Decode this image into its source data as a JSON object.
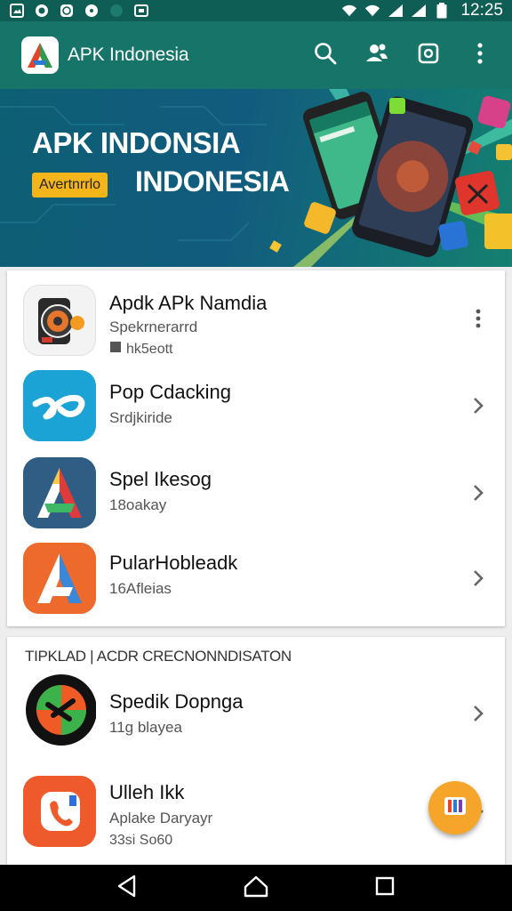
{
  "status_bar": {
    "time": "12:25",
    "icons": [
      "photo-icon",
      "chat-icon",
      "whatsapp-icon",
      "circle-icon",
      "gallery-icon",
      "hotspot-icon",
      "wifi-icon",
      "signal-icon",
      "battery-icon"
    ]
  },
  "app_bar": {
    "title": "APK Indonesia",
    "actions": [
      "search-icon",
      "users-icon",
      "screenshot-icon",
      "more-icon"
    ]
  },
  "banner": {
    "title": "APK INDONSIA",
    "badge": "Avertnrrlo",
    "subtitle": "INDONESIA"
  },
  "featured_list": [
    {
      "name": "Apdk APk Namdia",
      "sub": "Spekrnerarrd",
      "meta": "hk5eott",
      "action": "more-vertical-icon"
    },
    {
      "name": "Pop Cdacking",
      "sub": "Srdjkiride",
      "meta": "",
      "action": "chevron-right-icon"
    },
    {
      "name": "Spel Ikesog",
      "sub": "18oakay",
      "meta": "",
      "action": "chevron-right-icon"
    },
    {
      "name": "PularHobleadk",
      "sub": "16Afleias",
      "meta": "",
      "action": "chevron-right-icon"
    }
  ],
  "section2": {
    "title": "TIPKLAD | ACDR CRECNONNDISATON",
    "items": [
      {
        "name": "Spedik Dopnga",
        "sub": "11g blayea",
        "meta": "",
        "action": "chevron-right-icon"
      },
      {
        "name": "Ulleh Ikk",
        "sub": "Aplake Daryayr",
        "meta": "33si So60",
        "action": "chevron-right-icon"
      }
    ]
  },
  "colors": {
    "status_bar": "#0f5e55",
    "app_bar": "#167568",
    "fab": "#f4a52a",
    "badge": "#f3b51a"
  }
}
